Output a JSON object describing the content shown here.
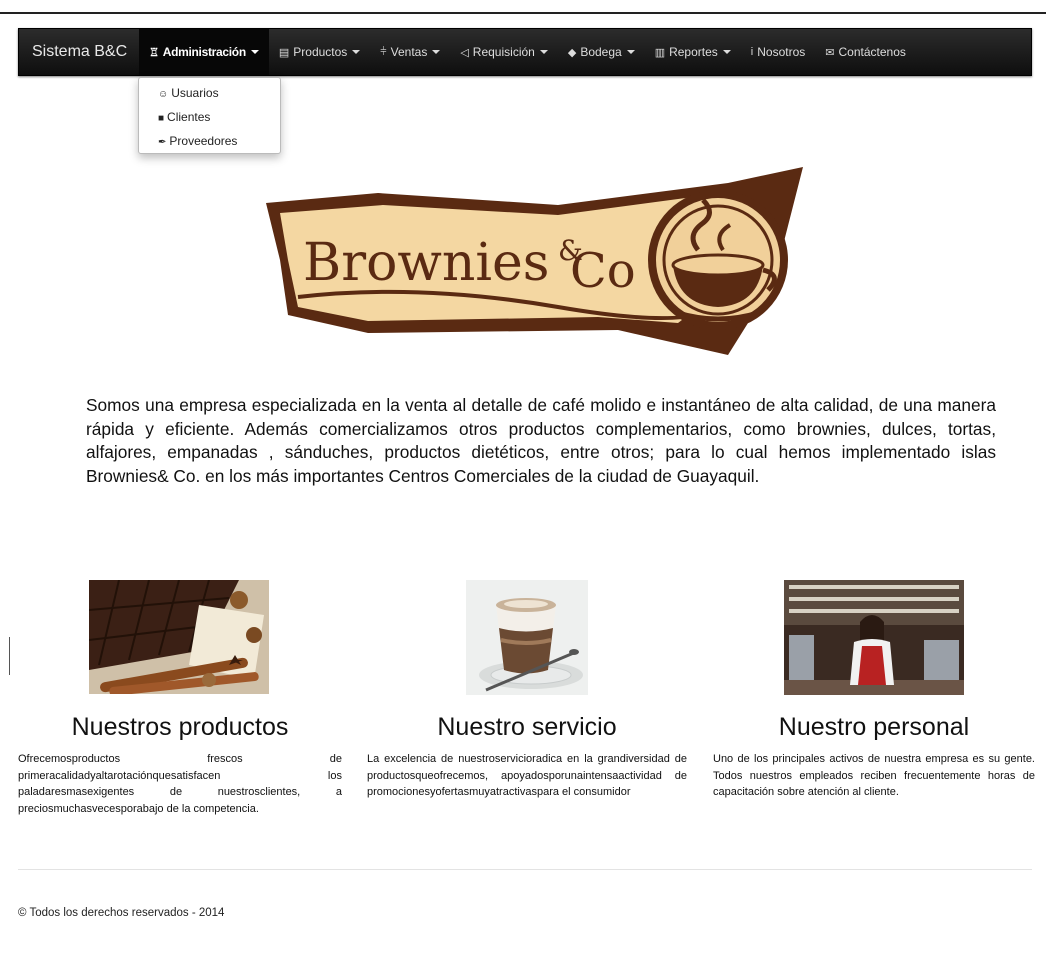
{
  "navbar": {
    "brand": "Sistema B&C",
    "items": [
      {
        "icon": "sitemap-icon",
        "glyph": "♖",
        "label": "Administración",
        "caret": true,
        "active": true
      },
      {
        "icon": "book-icon",
        "glyph": "▤",
        "label": "Productos",
        "caret": true
      },
      {
        "icon": "cutlery-icon",
        "glyph": "⫩",
        "label": "Ventas",
        "caret": true
      },
      {
        "icon": "bullhorn-icon",
        "glyph": "◁",
        "label": "Requisición",
        "caret": true
      },
      {
        "icon": "tags-icon",
        "glyph": "◆",
        "label": "Bodega",
        "caret": true
      },
      {
        "icon": "bar-chart-icon",
        "glyph": "▥",
        "label": "Reportes",
        "caret": true
      },
      {
        "icon": "info-icon",
        "glyph": "i",
        "label": "Nosotros",
        "caret": false
      },
      {
        "icon": "envelope-icon",
        "glyph": "✉",
        "label": "Contáctenos",
        "caret": false
      }
    ]
  },
  "dropdown": {
    "items": [
      {
        "icon": "users-icon",
        "glyph": "☺",
        "label": "Usuarios"
      },
      {
        "icon": "book-icon",
        "glyph": "■",
        "label": "Clientes"
      },
      {
        "icon": "cart-icon",
        "glyph": "✒",
        "label": "Proveedores"
      }
    ]
  },
  "logo": {
    "brand_word": "Brownies",
    "amp": "&",
    "suffix": "Co"
  },
  "intro": "Somos una empresa especializada en la venta al detalle de café molido e instantáneo de alta calidad, de una manera rápida y eficiente. Además comercializamos otros productos complementarios, como brownies, dulces, tortas, alfajores, empanadas , sánduches, productos dietéticos, entre otros; para lo cual hemos implementado islas Brownies& Co. en los más importantes Centros Comerciales de la ciudad de Guayaquil.",
  "features": [
    {
      "title": "Nuestros productos",
      "text": "Ofrecemosproductos frescos de primeracalidadyaltarotaciónquesatisfacen los paladaresmasexigentes de nuestrosclientes, a preciosmuchasvecesporabajo de la competencia."
    },
    {
      "title": "Nuestro servicio",
      "text": "La excelencia de nuestroservicioradica en la grandiversidad de productosqueofrecemos, apoyadosporunaintensaactividad de promocionesyofertasmuyatractivaspara el consumidor"
    },
    {
      "title": "Nuestro personal",
      "text": "Uno de los principales activos de nuestra empresa es su gente. Todos nuestros empleados reciben frecuentemente horas de capacitación sobre atención al cliente."
    }
  ],
  "footer": "© Todos los derechos reservados - 2014",
  "colors": {
    "navbar": "#111111",
    "logo_banner": "#f3d6a0",
    "logo_brown": "#5a2a12"
  }
}
